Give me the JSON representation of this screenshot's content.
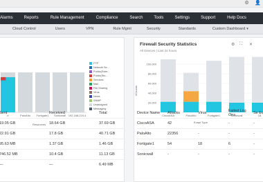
{
  "topbar": {
    "icons": [
      "gear-icon",
      "user-icon"
    ],
    "icon_glyphs": [
      "⚙",
      "👤"
    ]
  },
  "main_nav": [
    "Alarms",
    "Reports",
    "Rule Management",
    "Compliance",
    "Search",
    "Tools",
    "Settings",
    "Support",
    "Help Docs"
  ],
  "sub_nav": [
    "Cloud Control",
    "Users",
    "VPN",
    "Rule Mgmt",
    "Security",
    "Standards",
    "Custom Dashboard"
  ],
  "left_chart": {
    "xlabel": "Resources",
    "categories": [
      "e",
      "PaloAlto",
      "Fortigate1",
      "Sonicwall",
      "192.168.224.4"
    ],
    "legend": [
      {
        "label": "FTP",
        "color": "#2ec4e6"
      },
      {
        "label": "Network Se...",
        "color": "#1f6fb2"
      },
      {
        "label": "Public(Exter...",
        "color": "#8e5bc9"
      },
      {
        "label": "Public(Sto...",
        "color": "#d83b3b"
      },
      {
        "label": "Services",
        "color": "#f39c2a"
      },
      {
        "label": "Mail",
        "color": "#2e9e5b"
      },
      {
        "label": "File Sharing",
        "color": "#c2185b"
      },
      {
        "label": "Virus",
        "color": "#8d6e63"
      },
      {
        "label": "News",
        "color": "#3949ab"
      },
      {
        "label": "SNMP",
        "color": "#9ccc65"
      },
      {
        "label": "Unassigned",
        "color": "#d4d9de"
      },
      {
        "label": "Messaging",
        "color": "#455a64"
      }
    ]
  },
  "left_table": {
    "headers": [
      "Sent",
      "Received",
      "Total"
    ],
    "rows": [
      [
        "19.05 GB",
        "18.64 GB",
        "37.69 GB"
      ],
      [
        "22.91 GB",
        "17.8 GB",
        "40.71 GB"
      ],
      [
        "95.63 MB",
        "1.37 GB",
        "1.46 GB"
      ],
      [
        "746.52 MB",
        "10.4 GB",
        "11.13 GB"
      ],
      [
        "—",
        "—",
        "6.49 MB"
      ]
    ]
  },
  "right_card": {
    "title": "Firewall Security Statistics",
    "subtitle": "All Devices | Last 24 hours",
    "icons": [
      "settings-icon",
      "maximize-icon",
      "close-icon"
    ],
    "icon_glyphs": [
      "⚙",
      "⛶",
      "✕"
    ]
  },
  "chart_data": {
    "type": "bar",
    "categories": [
      "CiscoASA",
      "PaloAlto",
      "Fortigate1",
      "Sonicwall",
      "18"
    ],
    "series": [
      {
        "values": [
          42,
          22356,
          54,
          0,
          0
        ],
        "color": "#23c6e0"
      },
      {
        "values": [
          0,
          22000,
          0,
          0,
          0
        ],
        "color": "#f4a742"
      },
      {
        "values": [
          88000,
          38000,
          85000,
          95000,
          95000
        ],
        "color": "#dfe3e7"
      }
    ],
    "ylabel": "#Counts",
    "xlabel": "Event Type",
    "y_ticks": [
      "100,000",
      "80,000",
      "60,000",
      "40,000",
      "20,000",
      "0"
    ],
    "ylim": [
      0,
      100000
    ]
  },
  "right_table": {
    "headers": [
      "Device Name",
      "Attacks",
      "Virus",
      "Failed Log Ons",
      "Se Ev"
    ],
    "rows": [
      [
        "CiscoASA",
        "42",
        "-",
        "-",
        "-"
      ],
      [
        "PaloAlto",
        "22356",
        "-",
        "-",
        "-"
      ],
      [
        "Fortigate1",
        "54",
        "18",
        "6",
        "-"
      ],
      [
        "Sonicwall",
        "-",
        "-",
        "-",
        "-"
      ]
    ]
  }
}
